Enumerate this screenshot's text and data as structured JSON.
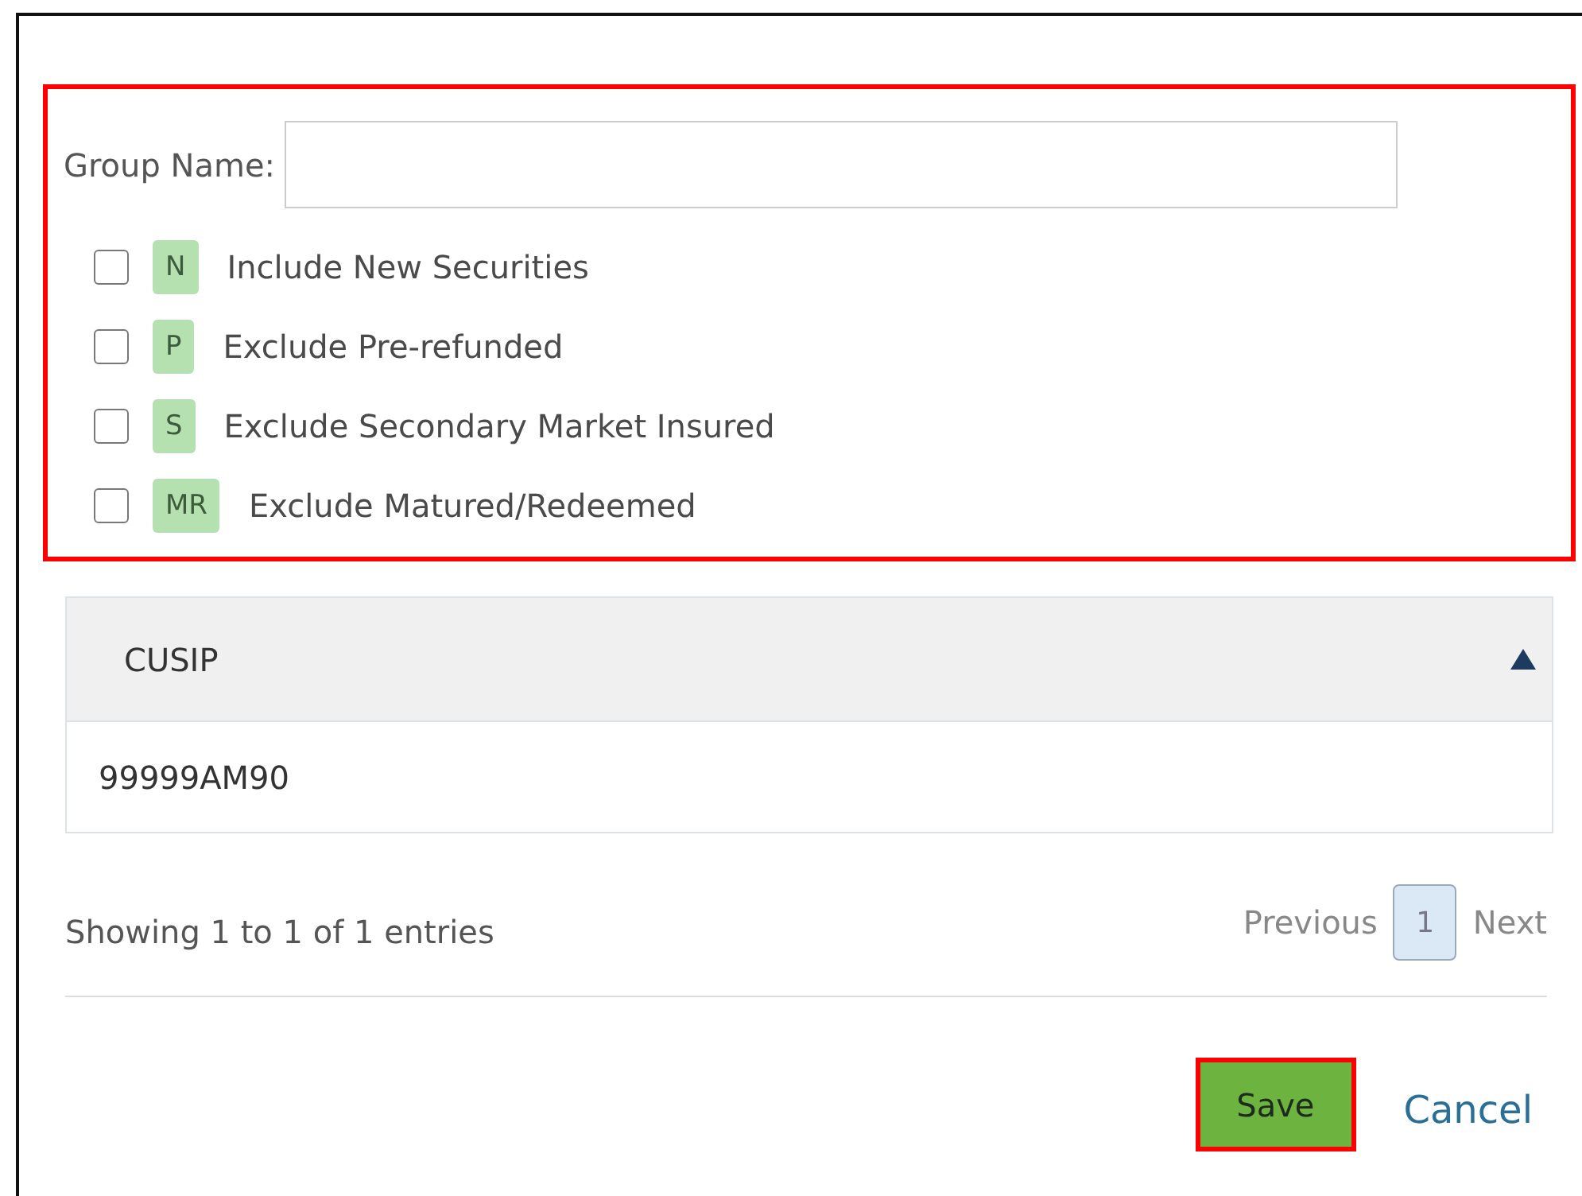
{
  "form": {
    "group_name": {
      "label": "Group Name:"
    },
    "options": [
      {
        "badge": "N",
        "label": "Include New Securities",
        "checked": false
      },
      {
        "badge": "P",
        "label": "Exclude Pre-refunded",
        "checked": false
      },
      {
        "badge": "S",
        "label": "Exclude Secondary Market Insured",
        "checked": false
      },
      {
        "badge": "MR",
        "label": "Exclude Matured/Redeemed",
        "checked": false
      }
    ]
  },
  "table": {
    "columns": [
      {
        "label": "CUSIP",
        "sorted_ascending": true
      }
    ],
    "rows": [
      [
        "99999AM90"
      ]
    ]
  },
  "footer": {
    "info": "Showing 1 to 1 of 1 entries",
    "pagination": [
      {
        "kind": "link",
        "label": "Previous",
        "disabled": true
      },
      {
        "kind": "page",
        "label": "1",
        "selected": true
      },
      {
        "kind": "link",
        "label": "Next",
        "disabled": true
      }
    ]
  },
  "buttons": [
    {
      "kind": "primary",
      "label": "Save"
    },
    {
      "kind": "link",
      "label": "Cancel"
    }
  ]
}
